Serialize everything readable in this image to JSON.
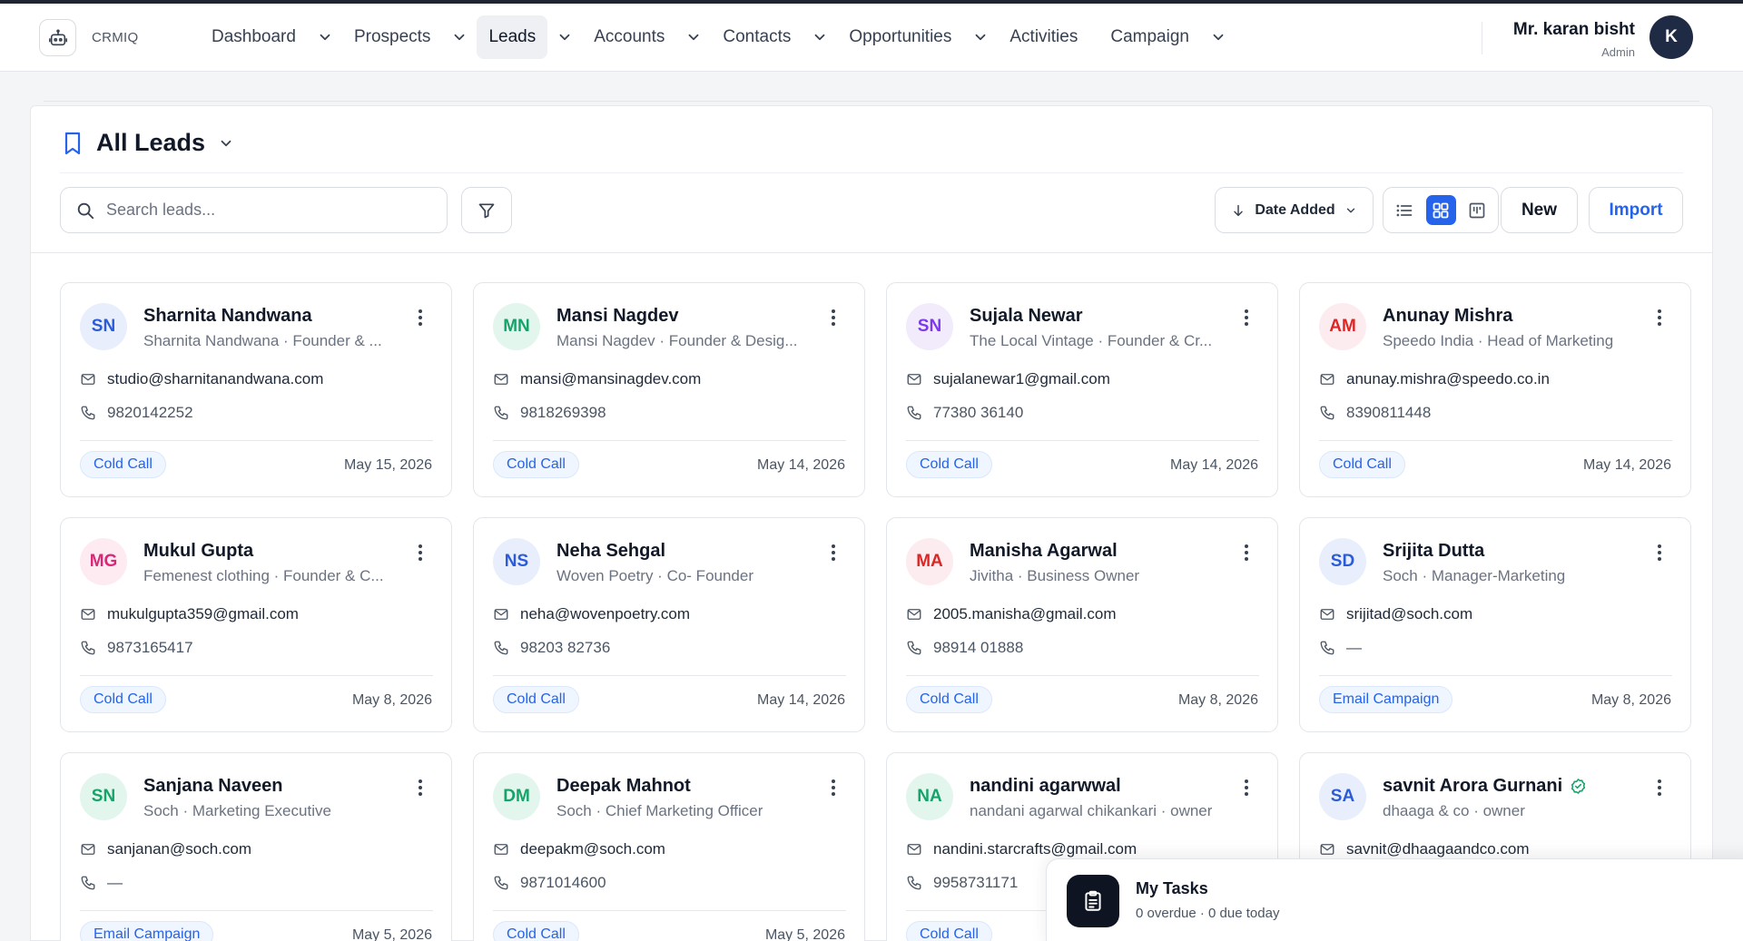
{
  "app": {
    "brand": "CRMIQ"
  },
  "nav": {
    "items": [
      {
        "label": "Dashboard",
        "has_menu": true,
        "active": false
      },
      {
        "label": "Prospects",
        "has_menu": true,
        "active": false
      },
      {
        "label": "Leads",
        "has_menu": true,
        "active": true
      },
      {
        "label": "Accounts",
        "has_menu": true,
        "active": false
      },
      {
        "label": "Contacts",
        "has_menu": true,
        "active": false
      },
      {
        "label": "Opportunities",
        "has_menu": true,
        "active": false
      },
      {
        "label": "Activities",
        "has_menu": false,
        "active": false
      },
      {
        "label": "Campaign",
        "has_menu": true,
        "active": false
      }
    ]
  },
  "user": {
    "name": "Mr. karan bisht",
    "role": "Admin",
    "initial": "K"
  },
  "page": {
    "title": "All Leads"
  },
  "toolbar": {
    "search_placeholder": "Search leads...",
    "sort_label": "Date Added",
    "new_label": "New",
    "import_label": "Import",
    "view_modes": [
      "list",
      "grid",
      "board"
    ],
    "active_view": "grid"
  },
  "leads": [
    {
      "initials": "SN",
      "name": "Sharnita Nandwana",
      "subtitle": "Sharnita Nandwana · Founder & ...",
      "email": "studio@sharnitanandwana.com",
      "phone": "9820142252",
      "source": "Cold Call",
      "date": "May 15, 2026",
      "avatar_bg": "#e8eefc",
      "avatar_fg": "#2b5bd7",
      "verified": false
    },
    {
      "initials": "MN",
      "name": "Mansi Nagdev",
      "subtitle": "Mansi Nagdev · Founder & Desig...",
      "email": "mansi@mansinagdev.com",
      "phone": "9818269398",
      "source": "Cold Call",
      "date": "May 14, 2026",
      "avatar_bg": "#e3f6ee",
      "avatar_fg": "#16a36a",
      "verified": false
    },
    {
      "initials": "SN",
      "name": "Sujala Newar",
      "subtitle": "The Local Vintage · Founder & Cr...",
      "email": "sujalanewar1@gmail.com",
      "phone": "77380 36140",
      "source": "Cold Call",
      "date": "May 14, 2026",
      "avatar_bg": "#f1ebfb",
      "avatar_fg": "#7c3aed",
      "verified": false
    },
    {
      "initials": "AM",
      "name": "Anunay Mishra",
      "subtitle": "Speedo India · Head of Marketing",
      "email": "anunay.mishra@speedo.co.in",
      "phone": "8390811448",
      "source": "Cold Call",
      "date": "May 14, 2026",
      "avatar_bg": "#fdecef",
      "avatar_fg": "#dc2626",
      "verified": false
    },
    {
      "initials": "MG",
      "name": "Mukul Gupta",
      "subtitle": "Femenest clothing · Founder & C...",
      "email": "mukulgupta359@gmail.com",
      "phone": "9873165417",
      "source": "Cold Call",
      "date": "May 8, 2026",
      "avatar_bg": "#fdebf1",
      "avatar_fg": "#db2777",
      "verified": false
    },
    {
      "initials": "NS",
      "name": "Neha Sehgal",
      "subtitle": "Woven Poetry · Co- Founder",
      "email": "neha@wovenpoetry.com",
      "phone": "98203 82736",
      "source": "Cold Call",
      "date": "May 14, 2026",
      "avatar_bg": "#e8eefc",
      "avatar_fg": "#2b5bd7",
      "verified": false
    },
    {
      "initials": "MA",
      "name": "Manisha Agarwal",
      "subtitle": "Jivitha · Business Owner",
      "email": "2005.manisha@gmail.com",
      "phone": "98914 01888",
      "source": "Cold Call",
      "date": "May 8, 2026",
      "avatar_bg": "#fdecef",
      "avatar_fg": "#dc2626",
      "verified": false
    },
    {
      "initials": "SD",
      "name": "Srijita Dutta",
      "subtitle": "Soch · Manager-Marketing",
      "email": "srijitad@soch.com",
      "phone": "—",
      "source": "Email Campaign",
      "date": "May 8, 2026",
      "avatar_bg": "#e8eefc",
      "avatar_fg": "#2b5bd7",
      "verified": false
    },
    {
      "initials": "SN",
      "name": "Sanjana Naveen",
      "subtitle": "Soch · Marketing Executive",
      "email": "sanjanan@soch.com",
      "phone": "—",
      "source": "Email Campaign",
      "date": "May 5, 2026",
      "avatar_bg": "#e3f6ee",
      "avatar_fg": "#16a36a",
      "verified": false
    },
    {
      "initials": "DM",
      "name": "Deepak Mahnot",
      "subtitle": "Soch · Chief Marketing Officer",
      "email": "deepakm@soch.com",
      "phone": "9871014600",
      "source": "Cold Call",
      "date": "May 5, 2026",
      "avatar_bg": "#e3f6ee",
      "avatar_fg": "#16a36a",
      "verified": false
    },
    {
      "initials": "NA",
      "name": "nandini agarwwal",
      "subtitle": "nandani agarwal chikankari · owner",
      "email": "nandini.starcrafts@gmail.com",
      "phone": "9958731171",
      "source": "Cold Call",
      "date": "",
      "avatar_bg": "#e3f6ee",
      "avatar_fg": "#16a36a",
      "verified": false
    },
    {
      "initials": "SA",
      "name": "savnit Arora Gurnani",
      "subtitle": "dhaaga & co · owner",
      "email": "savnit@dhaagaandco.com",
      "phone": "",
      "source": "",
      "date": "",
      "avatar_bg": "#e8eefc",
      "avatar_fg": "#2b5bd7",
      "verified": true
    }
  ],
  "tasks_widget": {
    "title": "My Tasks",
    "summary": "0 overdue · 0 due today"
  },
  "colors": {
    "accent": "#2563eb",
    "nav_dark": "#1f2433",
    "tag_bg": "#eff6ff"
  }
}
